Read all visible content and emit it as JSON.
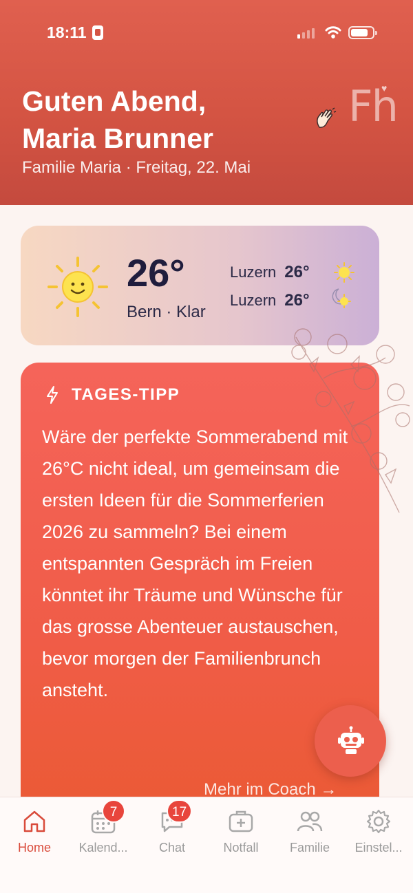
{
  "status": {
    "time": "18:11"
  },
  "header": {
    "greeting_line1": "Guten Abend,",
    "greeting_line2": "Maria Brunner",
    "subtitle": "Familie Maria · Freitag, 22. Mai",
    "logo_text": "Fh",
    "logo_heart": "♥",
    "wave_icon": "waving-hand-icon"
  },
  "weather": {
    "temperature": "26°",
    "location": "Bern · Klar",
    "icon": "sun-icon",
    "forecasts": [
      {
        "city": "Luzern",
        "temp": "26°",
        "icon": "sun-icon"
      },
      {
        "city": "Luzern",
        "temp": "26°",
        "icon": "moon-sun-icon"
      }
    ]
  },
  "tip": {
    "icon": "lightning-icon",
    "title": "TAGES-TIPP",
    "text": "Wäre der perfekte Sommerabend mit 26°C nicht ideal, um gemeinsam die ersten Ideen für die Sommerferien 2026 zu sammeln? Bei einem entspannten Gespräch im Freien könntet ihr Träume und Wünsche für das grosse Abenteuer austauschen, bevor morgen der Familienbrunch ansteht.",
    "more_link": "Mehr im Coach →"
  },
  "fab": {
    "icon": "robot-icon"
  },
  "tabs": [
    {
      "label": "Home",
      "icon": "home-icon",
      "active": true
    },
    {
      "label": "Kalend...",
      "icon": "calendar-icon",
      "badge": "7"
    },
    {
      "label": "Chat",
      "icon": "chat-icon",
      "badge": "17"
    },
    {
      "label": "Notfall",
      "icon": "first-aid-icon"
    },
    {
      "label": "Familie",
      "icon": "people-icon"
    },
    {
      "label": "Einstel...",
      "icon": "gear-icon"
    }
  ],
  "colors": {
    "header": "#d45443",
    "accent": "#d94b3b",
    "tip_card": "#f05c47",
    "badge": "#e8453c"
  }
}
